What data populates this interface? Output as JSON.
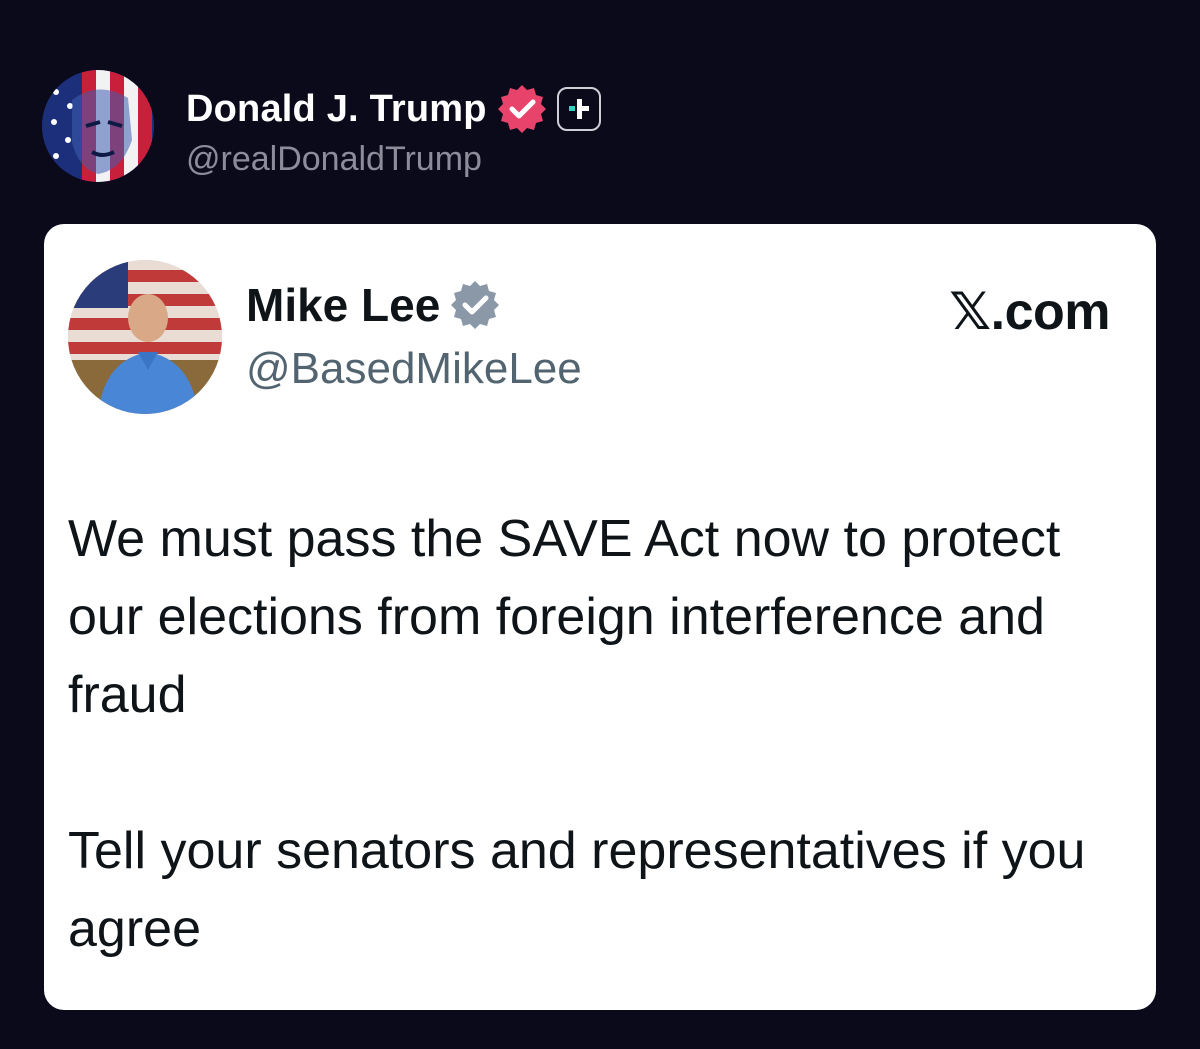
{
  "post": {
    "author": {
      "name": "Donald J. Trump",
      "handle": "@realDonaldTrump",
      "badge_color": "#e8436b",
      "avatar_icon": "flag-portrait-avatar"
    }
  },
  "quoted_post": {
    "author": {
      "name": "Mike Lee",
      "handle": "@BasedMikeLee",
      "badge_color": "#8a98a8",
      "avatar_icon": "portrait-photo-avatar"
    },
    "source": {
      "glyph": "𝕏",
      "domain": ".com"
    },
    "paragraphs": [
      "We must pass the SAVE Act now to protect our elections from foreign interference and fraud",
      "Tell your senators and representatives if you agree"
    ]
  },
  "colors": {
    "background": "#0b0a1a",
    "card": "#ffffff",
    "follow_accent": "#2fd3c0"
  }
}
